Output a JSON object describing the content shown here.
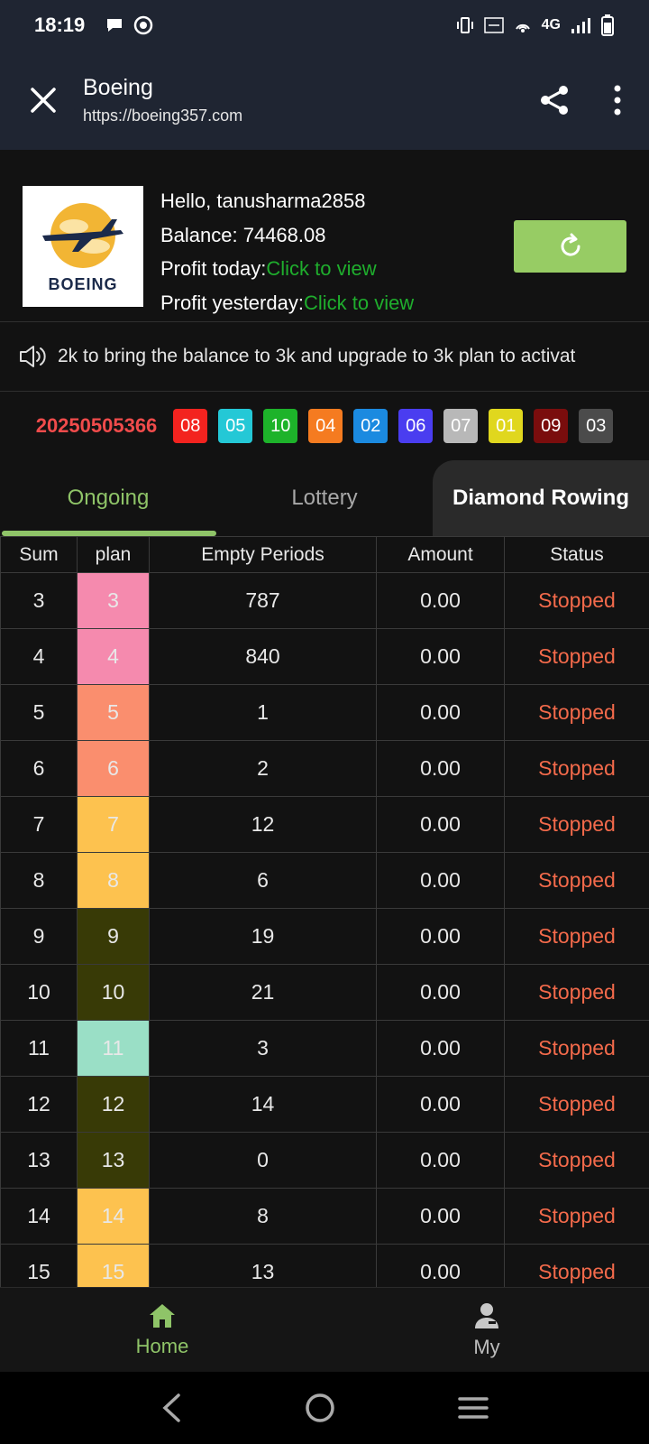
{
  "status_bar": {
    "time": "18:19",
    "network": "4G"
  },
  "app_bar": {
    "title": "Boeing",
    "url": "https://boeing357.com"
  },
  "header": {
    "logo_text": "BOEING",
    "greeting": "Hello, tanusharma2858",
    "balance_label": "Balance: 74468.08",
    "profit_today_label": "Profit today:",
    "profit_today_link": "Click to view",
    "profit_yesterday_label": "Profit yesterday:",
    "profit_yesterday_link": "Click to view",
    "accent_color": "#97cc64"
  },
  "marquee": {
    "text": " 2k to bring the balance to 3k and upgrade to 3k plan to activat"
  },
  "period": {
    "id": "20250505366",
    "balls": [
      {
        "n": "08",
        "color": "#f3231f"
      },
      {
        "n": "05",
        "color": "#24c8d6"
      },
      {
        "n": "10",
        "color": "#1db32a"
      },
      {
        "n": "04",
        "color": "#f57b20"
      },
      {
        "n": "02",
        "color": "#1b8ae0"
      },
      {
        "n": "06",
        "color": "#4a3df0"
      },
      {
        "n": "07",
        "color": "#b8b8b8"
      },
      {
        "n": "01",
        "color": "#e0d71e"
      },
      {
        "n": "09",
        "color": "#7a0d0d"
      },
      {
        "n": "03",
        "color": "#4b4b4b"
      }
    ]
  },
  "tabs": [
    {
      "label": "Ongoing"
    },
    {
      "label": "Lottery"
    },
    {
      "label": "Diamond Rowing"
    }
  ],
  "table": {
    "headers": [
      "Sum",
      "plan",
      "Empty Periods",
      "Amount",
      "Status"
    ],
    "rows": [
      {
        "sum": "3",
        "plan": "3",
        "empty": "787",
        "amount": "0.00",
        "status": "Stopped",
        "plan_color": "#f58aae"
      },
      {
        "sum": "4",
        "plan": "4",
        "empty": "840",
        "amount": "0.00",
        "status": "Stopped",
        "plan_color": "#f58aae"
      },
      {
        "sum": "5",
        "plan": "5",
        "empty": "1",
        "amount": "0.00",
        "status": "Stopped",
        "plan_color": "#fa8e6e"
      },
      {
        "sum": "6",
        "plan": "6",
        "empty": "2",
        "amount": "0.00",
        "status": "Stopped",
        "plan_color": "#fa8e6e"
      },
      {
        "sum": "7",
        "plan": "7",
        "empty": "12",
        "amount": "0.00",
        "status": "Stopped",
        "plan_color": "#fdc24f"
      },
      {
        "sum": "8",
        "plan": "8",
        "empty": "6",
        "amount": "0.00",
        "status": "Stopped",
        "plan_color": "#fdc24f"
      },
      {
        "sum": "9",
        "plan": "9",
        "empty": "19",
        "amount": "0.00",
        "status": "Stopped",
        "plan_color": "#383a06"
      },
      {
        "sum": "10",
        "plan": "10",
        "empty": "21",
        "amount": "0.00",
        "status": "Stopped",
        "plan_color": "#383a06"
      },
      {
        "sum": "11",
        "plan": "11",
        "empty": "3",
        "amount": "0.00",
        "status": "Stopped",
        "plan_color": "#9adfc6"
      },
      {
        "sum": "12",
        "plan": "12",
        "empty": "14",
        "amount": "0.00",
        "status": "Stopped",
        "plan_color": "#383a06"
      },
      {
        "sum": "13",
        "plan": "13",
        "empty": "0",
        "amount": "0.00",
        "status": "Stopped",
        "plan_color": "#383a06"
      },
      {
        "sum": "14",
        "plan": "14",
        "empty": "8",
        "amount": "0.00",
        "status": "Stopped",
        "plan_color": "#fdc24f"
      },
      {
        "sum": "15",
        "plan": "15",
        "empty": "13",
        "amount": "0.00",
        "status": "Stopped",
        "plan_color": "#fdc24f"
      }
    ]
  },
  "bottom_nav": [
    {
      "label": "Home",
      "icon": "home-icon"
    },
    {
      "label": "My",
      "icon": "user-icon"
    }
  ]
}
